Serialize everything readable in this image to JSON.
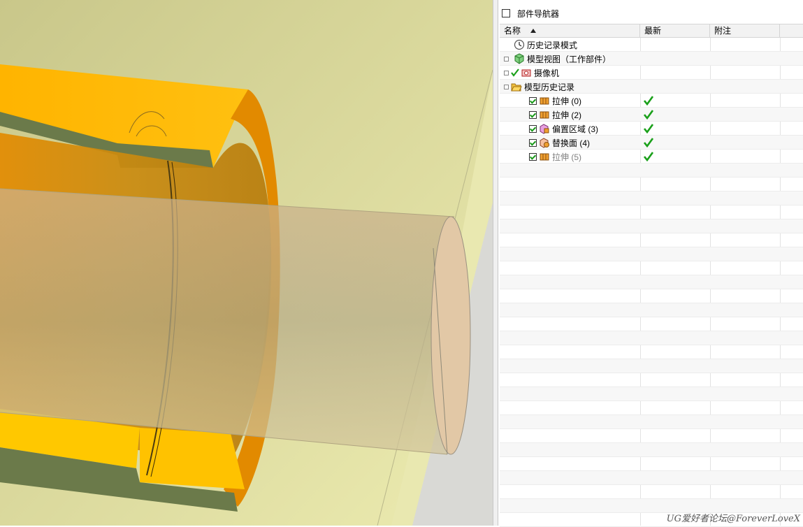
{
  "navigator": {
    "title": "部件导航器",
    "columns": {
      "name": "名称",
      "latest": "最新",
      "note": "附注"
    },
    "items": [
      {
        "label": "历史记录模式",
        "icon": "clock-icon",
        "latest": false
      },
      {
        "label": "模型视图（工作部件）",
        "icon": "model-view-icon",
        "latest": false
      },
      {
        "label": "摄像机",
        "icon": "camera-icon",
        "latest": false
      },
      {
        "label": "模型历史记录",
        "icon": "folder-open-icon",
        "latest": false
      },
      {
        "label": "拉伸 (0)",
        "icon": "extrude-icon",
        "latest": true
      },
      {
        "label": "拉伸 (2)",
        "icon": "extrude-icon",
        "latest": true
      },
      {
        "label": "偏置区域 (3)",
        "icon": "offset-region-icon",
        "latest": true
      },
      {
        "label": "替换面 (4)",
        "icon": "replace-face-icon",
        "latest": true
      },
      {
        "label": "拉伸 (5)",
        "icon": "extrude-icon",
        "latest": true
      }
    ]
  },
  "watermark": "UG爱好者论坛@ForeverLoveX",
  "colors": {
    "part_orange": "#ffb000",
    "face_green": "#6b7a4a",
    "shaft": "#d8c6a0",
    "background_plane": "#d6d48e"
  }
}
